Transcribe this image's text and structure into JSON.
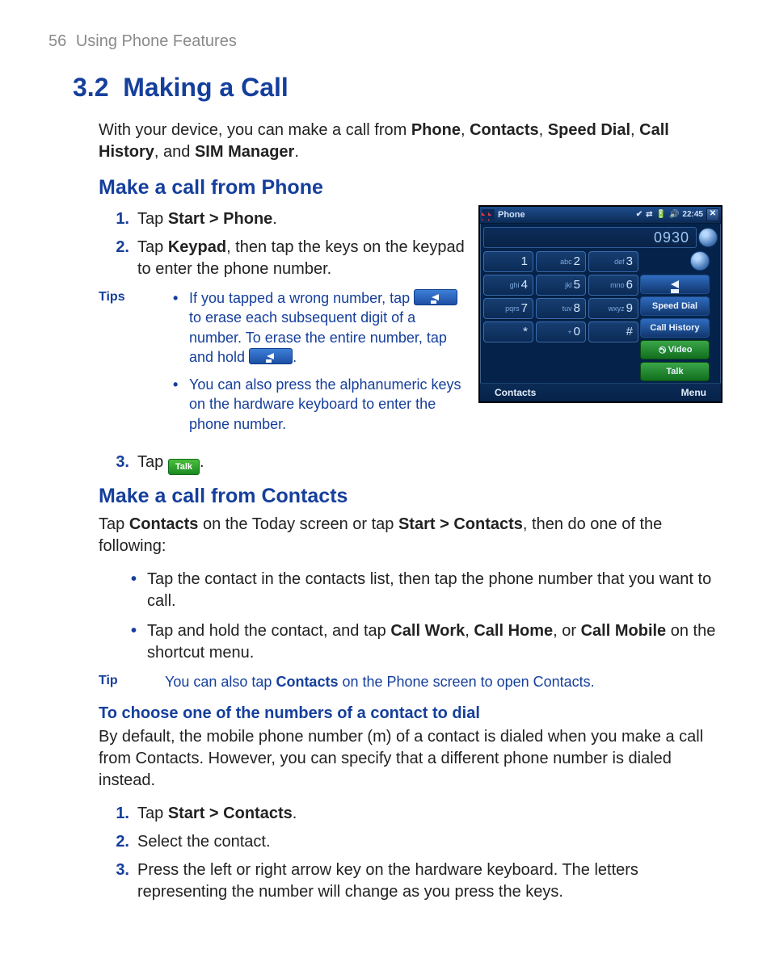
{
  "header": {
    "page_number": "56",
    "running_title": "Using Phone Features"
  },
  "section": {
    "number": "3.2",
    "title": "Making a Call"
  },
  "intro": {
    "pre": "With your device, you can make a call from ",
    "items": [
      "Phone",
      "Contacts",
      "Speed Dial",
      "Call History",
      "SIM Manager"
    ],
    "joiner_comma": ", ",
    "joiner_and": ", and ",
    "post": "."
  },
  "sec1": {
    "title": "Make a call from Phone",
    "steps": {
      "n1": "1.",
      "t1a": "Tap ",
      "t1b": "Start > Phone",
      "t1c": ".",
      "n2": "2.",
      "t2a": "Tap ",
      "t2b": "Keypad",
      "t2c": ", then tap the keys on the keypad to enter the phone number.",
      "n3": "3.",
      "t3a": "Tap ",
      "t3c": "."
    },
    "tips_label": "Tips",
    "tip1": {
      "a": "If you tapped a wrong number, tap ",
      "b": " to erase each subsequent digit of a number. To erase the entire number, tap and hold ",
      "c": "."
    },
    "tip2": "You can also press the alphanumeric keys on the hardware keyboard to enter the phone number.",
    "talk_label": "Talk"
  },
  "sec2": {
    "title": "Make a call from Contacts",
    "lead_a": "Tap ",
    "lead_b": "Contacts",
    "lead_c": " on the Today screen or tap ",
    "lead_d": "Start > Contacts",
    "lead_e": ", then do one of the following:",
    "b1": "Tap the contact in the contacts list, then tap the phone number that you want to call.",
    "b2a": "Tap and hold the contact, and tap ",
    "b2b": "Call Work",
    "b2c": ", ",
    "b2d": "Call Home",
    "b2e": ", or ",
    "b2f": "Call Mobile",
    "b2g": " on the shortcut menu.",
    "tip_label": "Tip",
    "tip_a": "You can also tap ",
    "tip_b": "Contacts",
    "tip_c": " on the Phone screen to open Contacts."
  },
  "sec3": {
    "title": "To choose one of the numbers of a contact to dial",
    "lead": "By default, the mobile phone number (m) of a contact is dialed when you make a call from Contacts. However, you can specify that a different phone number is dialed instead.",
    "n1": "1.",
    "t1a": "Tap ",
    "t1b": "Start > Contacts",
    "t1c": ".",
    "n2": "2.",
    "t2": "Select the contact.",
    "n3": "3.",
    "t3": "Press the left or right arrow key on the hardware keyboard. The letters representing the number will change as you press the keys."
  },
  "phone": {
    "title": "Phone",
    "time": "22:45",
    "display": "0930",
    "keys": [
      {
        "sub": "",
        "main": "1"
      },
      {
        "sub": "abc",
        "main": "2"
      },
      {
        "sub": "def",
        "main": "3"
      },
      {
        "sub": "ghi",
        "main": "4"
      },
      {
        "sub": "jkl",
        "main": "5"
      },
      {
        "sub": "mno",
        "main": "6"
      },
      {
        "sub": "pqrs",
        "main": "7"
      },
      {
        "sub": "tuv",
        "main": "8"
      },
      {
        "sub": "wxyz",
        "main": "9"
      },
      {
        "sub": "",
        "main": "*"
      },
      {
        "sub": "+",
        "main": "0"
      },
      {
        "sub": "",
        "main": "#"
      }
    ],
    "side": {
      "speed_dial": "Speed Dial",
      "call_history": "Call History",
      "video": "Video",
      "talk": "Talk"
    },
    "status_icons": [
      "✔",
      "⇄",
      "🔋",
      "🔊"
    ],
    "bottom_left": "Contacts",
    "bottom_right": "Menu"
  }
}
